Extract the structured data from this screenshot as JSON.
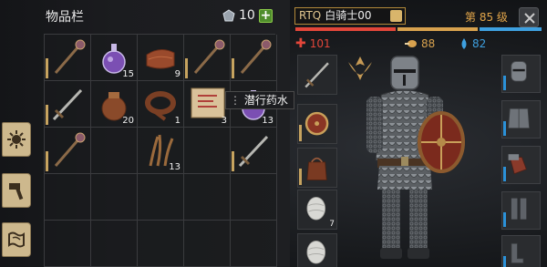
{
  "inventory": {
    "title": "物品栏",
    "gem_count": "10",
    "add_label": "+",
    "slots": [
      {
        "item": "mace-icon",
        "count": "",
        "bar": true
      },
      {
        "item": "potion-icon",
        "count": "15",
        "bar": false
      },
      {
        "item": "leather-icon",
        "count": "9",
        "bar": false
      },
      {
        "item": "mace-icon",
        "count": "",
        "bar": true
      },
      {
        "item": "mace-icon",
        "count": "",
        "bar": true
      },
      {
        "item": "sword-icon",
        "count": "",
        "bar": true
      },
      {
        "item": "pouch-icon",
        "count": "20",
        "bar": false
      },
      {
        "item": "rope-icon",
        "count": "1",
        "bar": false
      },
      {
        "item": "scroll-icon",
        "count": "3",
        "bar": false
      },
      {
        "item": "potion-icon",
        "count": "13",
        "bar": false
      },
      {
        "item": "mace-icon",
        "count": "",
        "bar": true
      },
      {
        "item": "empty",
        "count": "",
        "bar": false
      },
      {
        "item": "fiber-icon",
        "count": "13",
        "bar": false
      },
      {
        "item": "empty",
        "count": "",
        "bar": false
      },
      {
        "item": "sword-icon",
        "count": "",
        "bar": true
      }
    ],
    "tooltip": "潜行药水"
  },
  "character": {
    "tag": "RTQ",
    "name": "白骑士00",
    "level": "第 85 级",
    "health": "101",
    "hunger": "88",
    "water": "82",
    "colors": {
      "health": "#e3463a",
      "hunger": "#d8a24e",
      "water": "#3ea0e0"
    }
  },
  "equip_slots": [
    {
      "item": "sword-icon",
      "count": "",
      "bar": false
    },
    {
      "item": "shield-icon",
      "count": "",
      "bar": true
    },
    {
      "item": "bag-icon",
      "count": "",
      "bar": true
    },
    {
      "item": "bandage-icon",
      "count": "7",
      "bar": false
    },
    {
      "item": "bandage-icon",
      "count": "",
      "bar": false
    }
  ],
  "armor_slots": [
    {
      "item": "helmet-icon"
    },
    {
      "item": "chest-armor-icon"
    },
    {
      "item": "gauntlet-icon"
    },
    {
      "item": "leg-armor-icon"
    },
    {
      "item": "boots-icon"
    }
  ]
}
